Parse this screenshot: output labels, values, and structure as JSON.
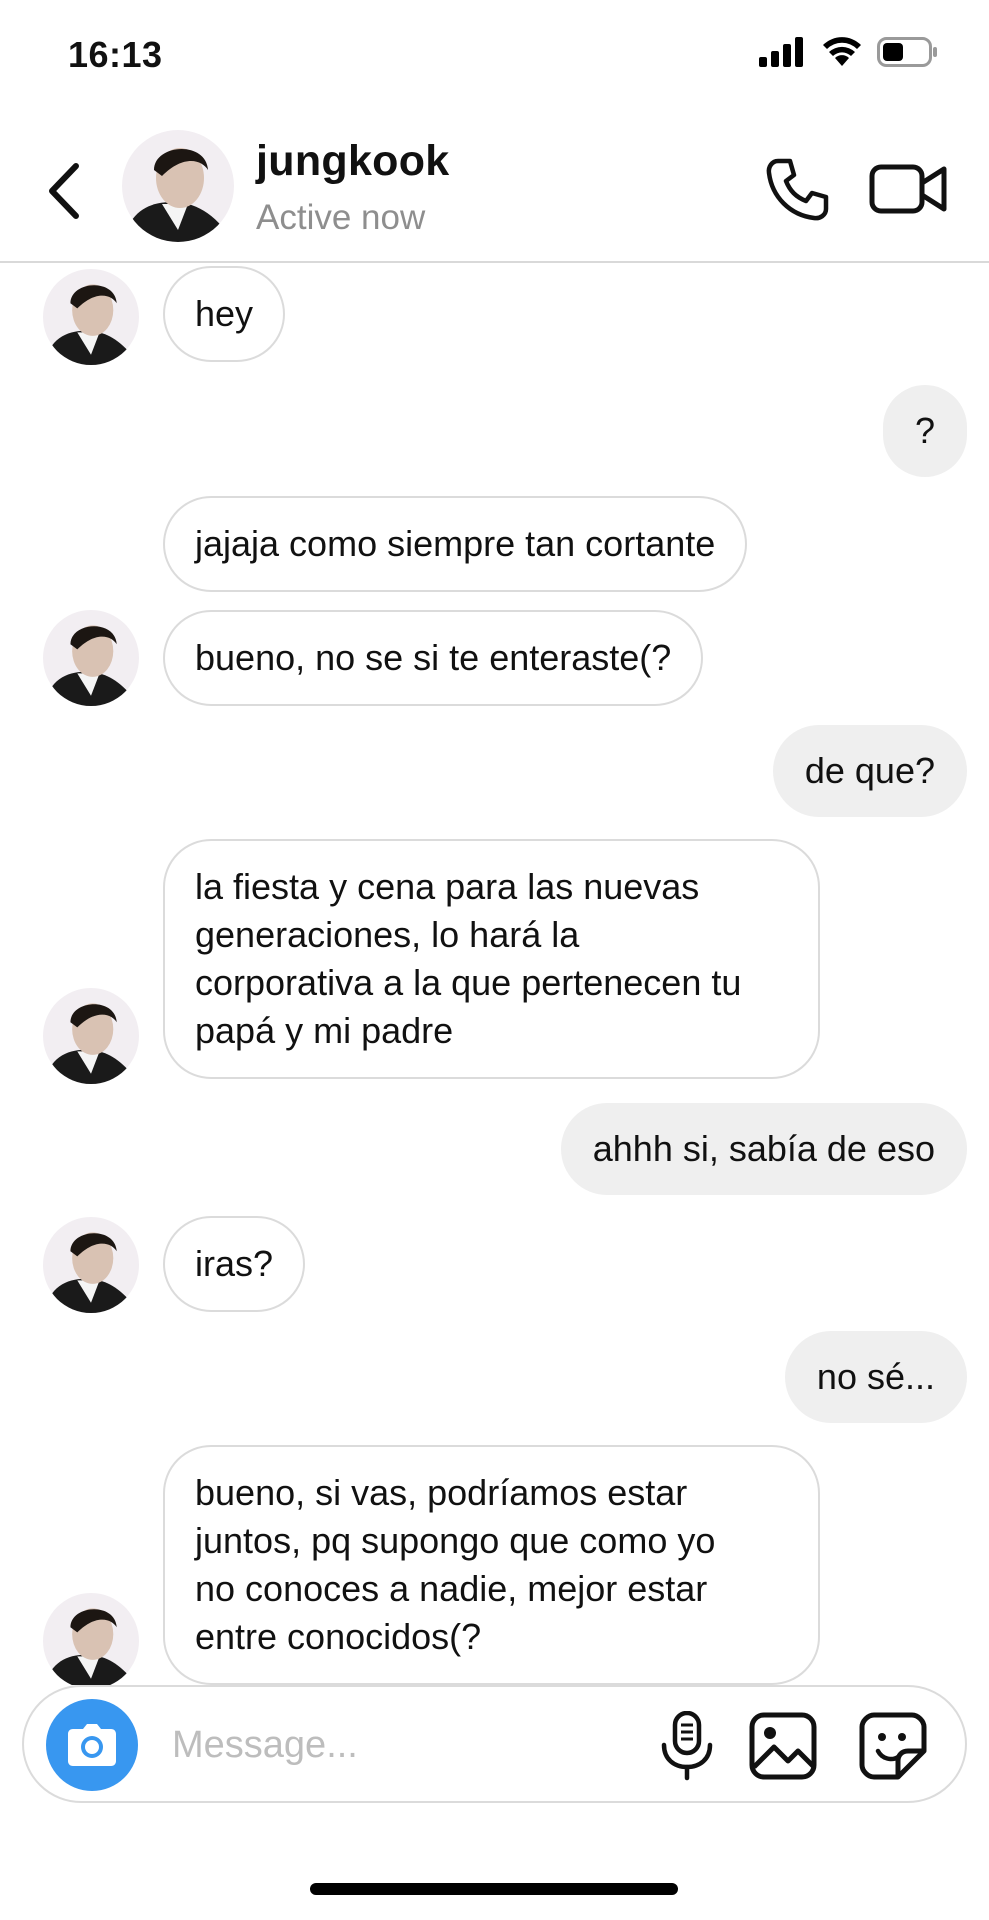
{
  "status_bar": {
    "time": "16:13"
  },
  "header": {
    "name": "jungkook",
    "status": "Active now"
  },
  "messages": [
    {
      "from": "them",
      "text": "hey"
    },
    {
      "from": "me",
      "text": "?"
    },
    {
      "from": "them",
      "text": "jajaja como siempre tan cortante"
    },
    {
      "from": "them",
      "text": "bueno, no se si te enteraste(?"
    },
    {
      "from": "me",
      "text": "de que?"
    },
    {
      "from": "them",
      "lines": [
        "la fiesta y cena para las nuevas",
        "generaciones, lo hará la",
        "corporativa a la que pertenecen tu",
        "papá y mi padre"
      ]
    },
    {
      "from": "me",
      "text": "ahhh si, sabía de eso"
    },
    {
      "from": "them",
      "text": "iras?"
    },
    {
      "from": "me",
      "text": "no sé..."
    },
    {
      "from": "them",
      "lines": [
        "bueno, si vas, podríamos estar",
        "juntos, pq supongo que como yo",
        "no conoces a nadie, mejor estar",
        "entre conocidos(?"
      ]
    }
  ],
  "composer": {
    "placeholder": "Message..."
  },
  "colors": {
    "accent": "#3897f0",
    "outgoing_bubble": "#efefef",
    "border": "#dbdbdb",
    "muted": "#8e8e8e"
  },
  "icons": {
    "back": "chevron-left-icon",
    "call": "phone-icon",
    "video": "video-camera-icon",
    "camera": "camera-icon",
    "mic": "microphone-icon",
    "gallery": "image-icon",
    "sticker": "sticker-icon"
  }
}
